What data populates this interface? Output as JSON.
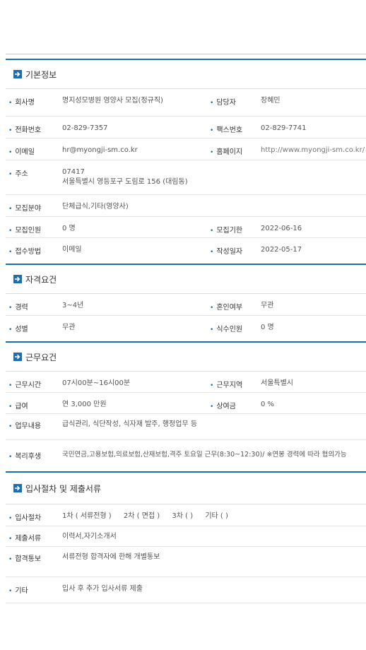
{
  "sections": {
    "basic": {
      "title": "기본정보",
      "company_label": "회사명",
      "company": "명지성모병원 영양사 모집(정규직)",
      "manager_label": "담당자",
      "manager": "장혜민",
      "phone_label": "전화번호",
      "phone": "02-829-7357",
      "fax_label": "팩스번호",
      "fax": "02-829-7741",
      "email_label": "이메일",
      "email": "hr@myongji-sm.co.kr",
      "homepage_label": "홈페이지",
      "homepage": "http://www.myongji-sm.co.kr/",
      "address_label": "주소",
      "zipcode": "07417",
      "address": "서울특별시 영등포구 도림로 156 (대림동)",
      "field_label": "모집분야",
      "field": "단체급식,기타(영양사)",
      "count_label": "모집인원",
      "count": "0 명",
      "deadline_label": "모집기한",
      "deadline": "2022-06-16",
      "method_label": "접수방법",
      "method": "이메일",
      "written_label": "작성일자",
      "written": "2022-05-17"
    },
    "qualification": {
      "title": "자격요건",
      "career_label": "경력",
      "career": "3~4년",
      "marriage_label": "혼인여부",
      "marriage": "무관",
      "gender_label": "성별",
      "gender": "무관",
      "meals_label": "식수인원",
      "meals": "0 명"
    },
    "work": {
      "title": "근무요건",
      "hours_label": "근무시간",
      "hours": "07시00분~16시00분",
      "region_label": "근무지역",
      "region": "서울특별시",
      "salary_label": "급여",
      "salary": "연 3,000 만원",
      "bonus_label": "상여금",
      "bonus": "0 %",
      "duty_label": "업무내용",
      "duty": "급식관리, 식단작성, 식자재 발주, 행정업무 등",
      "welfare_label": "복리후생",
      "welfare": "국민연금,고용보험,의료보험,산재보험,격주 토요일 근무(8:30~12:30)/ ※연봉 경력에 따라 협의가능"
    },
    "procedure": {
      "title": "입사절차 및 제출서류",
      "steps_label": "입사절차",
      "step1": "1차 ( 서류전형 )",
      "step2": "2차 ( 면접 )",
      "step3": "3차 ( )",
      "step4": "기타 ( )",
      "docs_label": "제출서류",
      "docs": "이력서,자기소개서",
      "notice_label": "합격통보",
      "notice": "서류전형 합격자에 한해 개별통보",
      "etc_label": "기타",
      "etc": "입사 후 추가 입사서류 제출"
    }
  },
  "colors": {
    "accent": "#1d6db3"
  },
  "icons": {
    "section": "arrow-right-square-icon"
  }
}
